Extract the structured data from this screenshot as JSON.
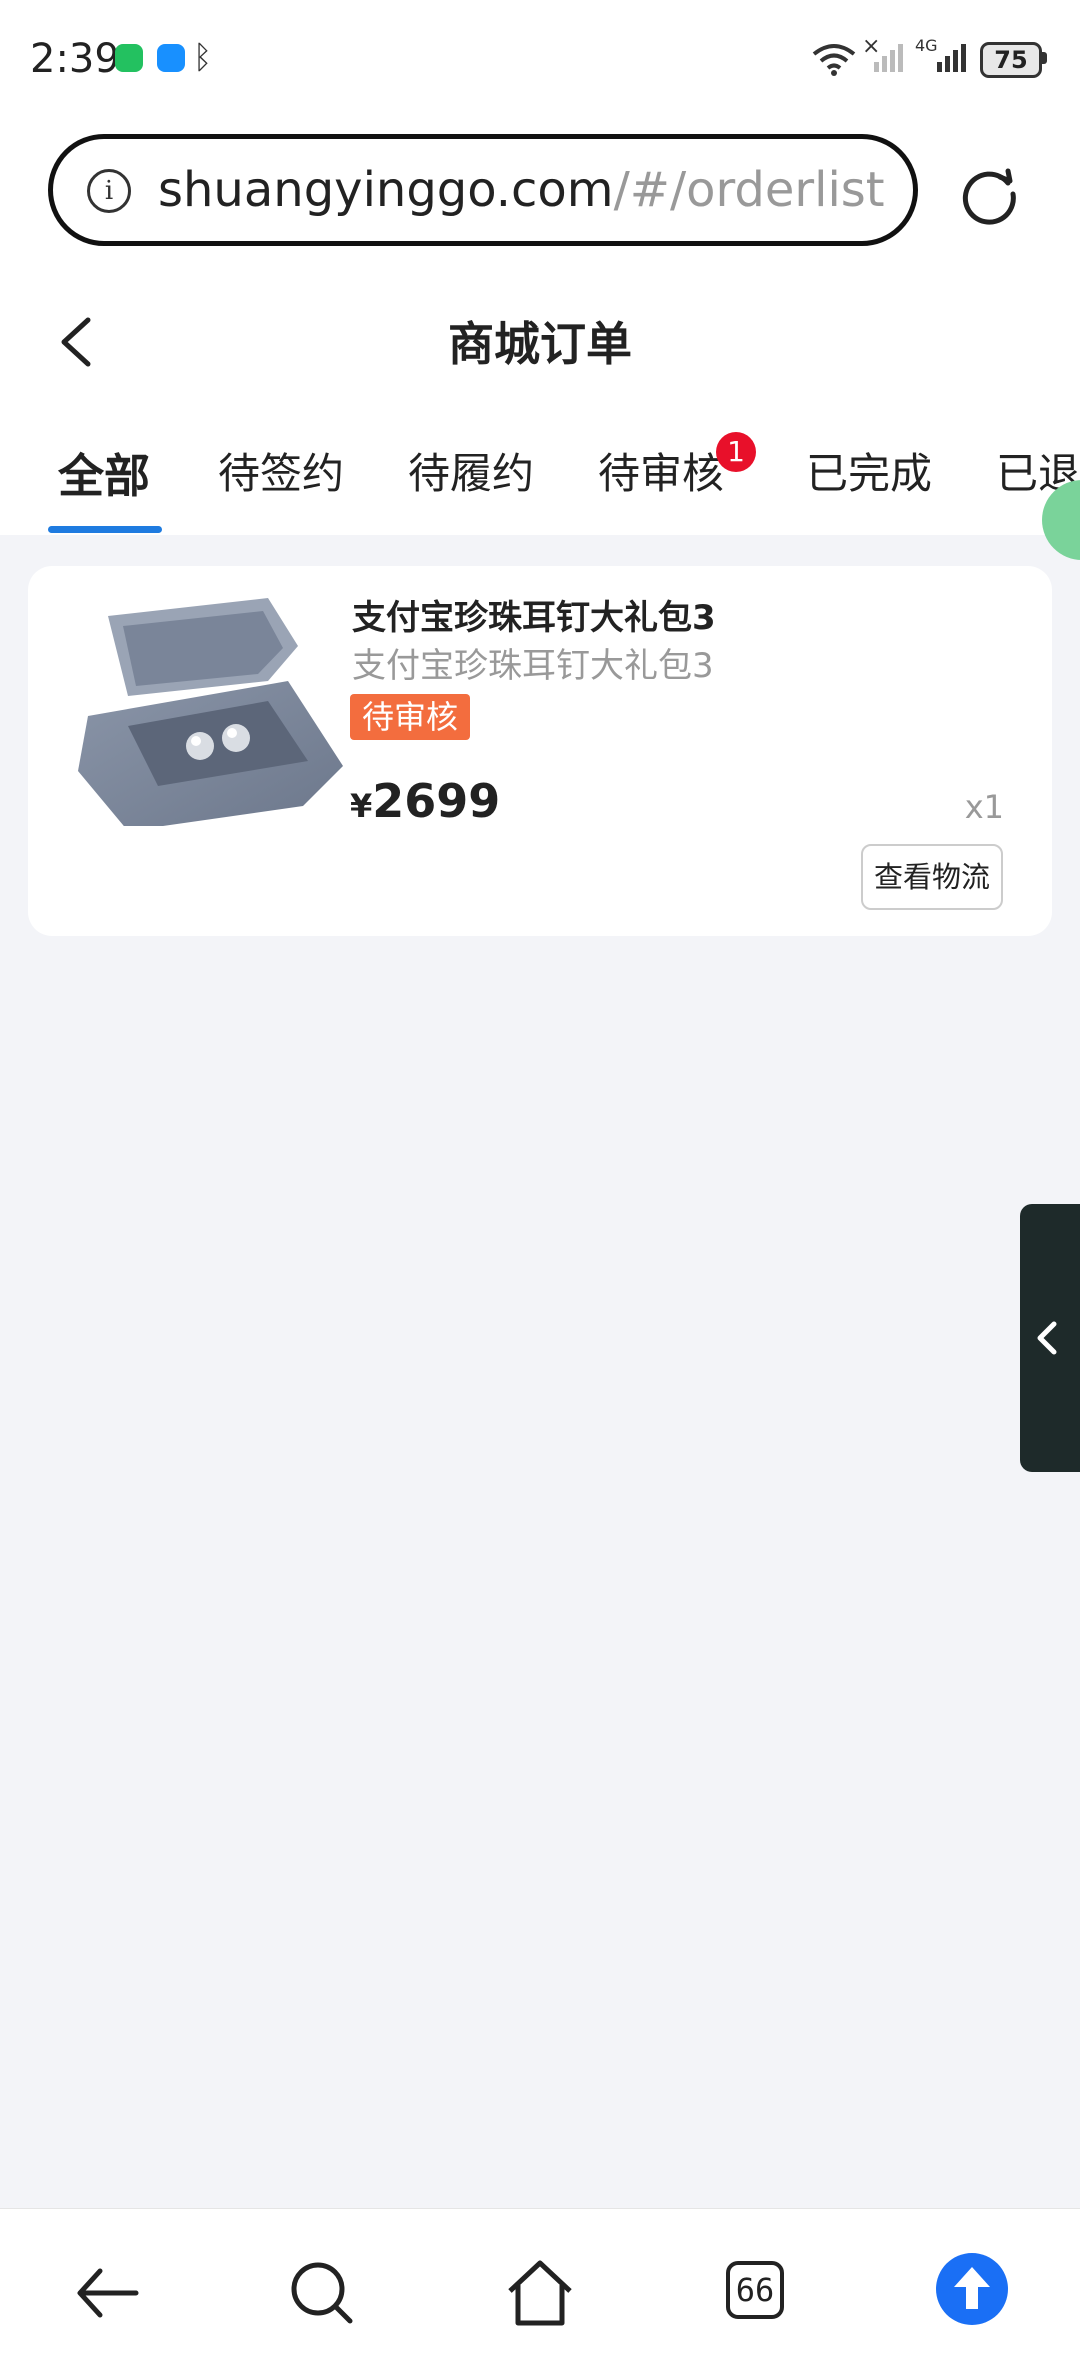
{
  "status_bar": {
    "time": "2:39",
    "battery": "75",
    "network_label": "4G"
  },
  "browser": {
    "url_host": "shuangyinggo.com",
    "url_path": "/#/orderlist"
  },
  "header": {
    "title": "商城订单"
  },
  "tabs": [
    {
      "label": "全部",
      "active": true
    },
    {
      "label": "待签约"
    },
    {
      "label": "待履约"
    },
    {
      "label": "待审核",
      "badge": "1"
    },
    {
      "label": "已完成"
    },
    {
      "label": "已退款"
    }
  ],
  "orders": [
    {
      "title": "支付宝珍珠耳钉大礼包3",
      "subtitle": "支付宝珍珠耳钉大礼包3",
      "status": "待审核",
      "currency": "¥",
      "price": "2699",
      "quantity": "x1",
      "action_label": "查看物流"
    }
  ],
  "bottom_nav": {
    "tabs_count": "66"
  },
  "colors": {
    "accent": "#1e7be0",
    "badge": "#e8102a",
    "status_tag": "#f36d3e",
    "page_bg": "#f3f4f8"
  }
}
